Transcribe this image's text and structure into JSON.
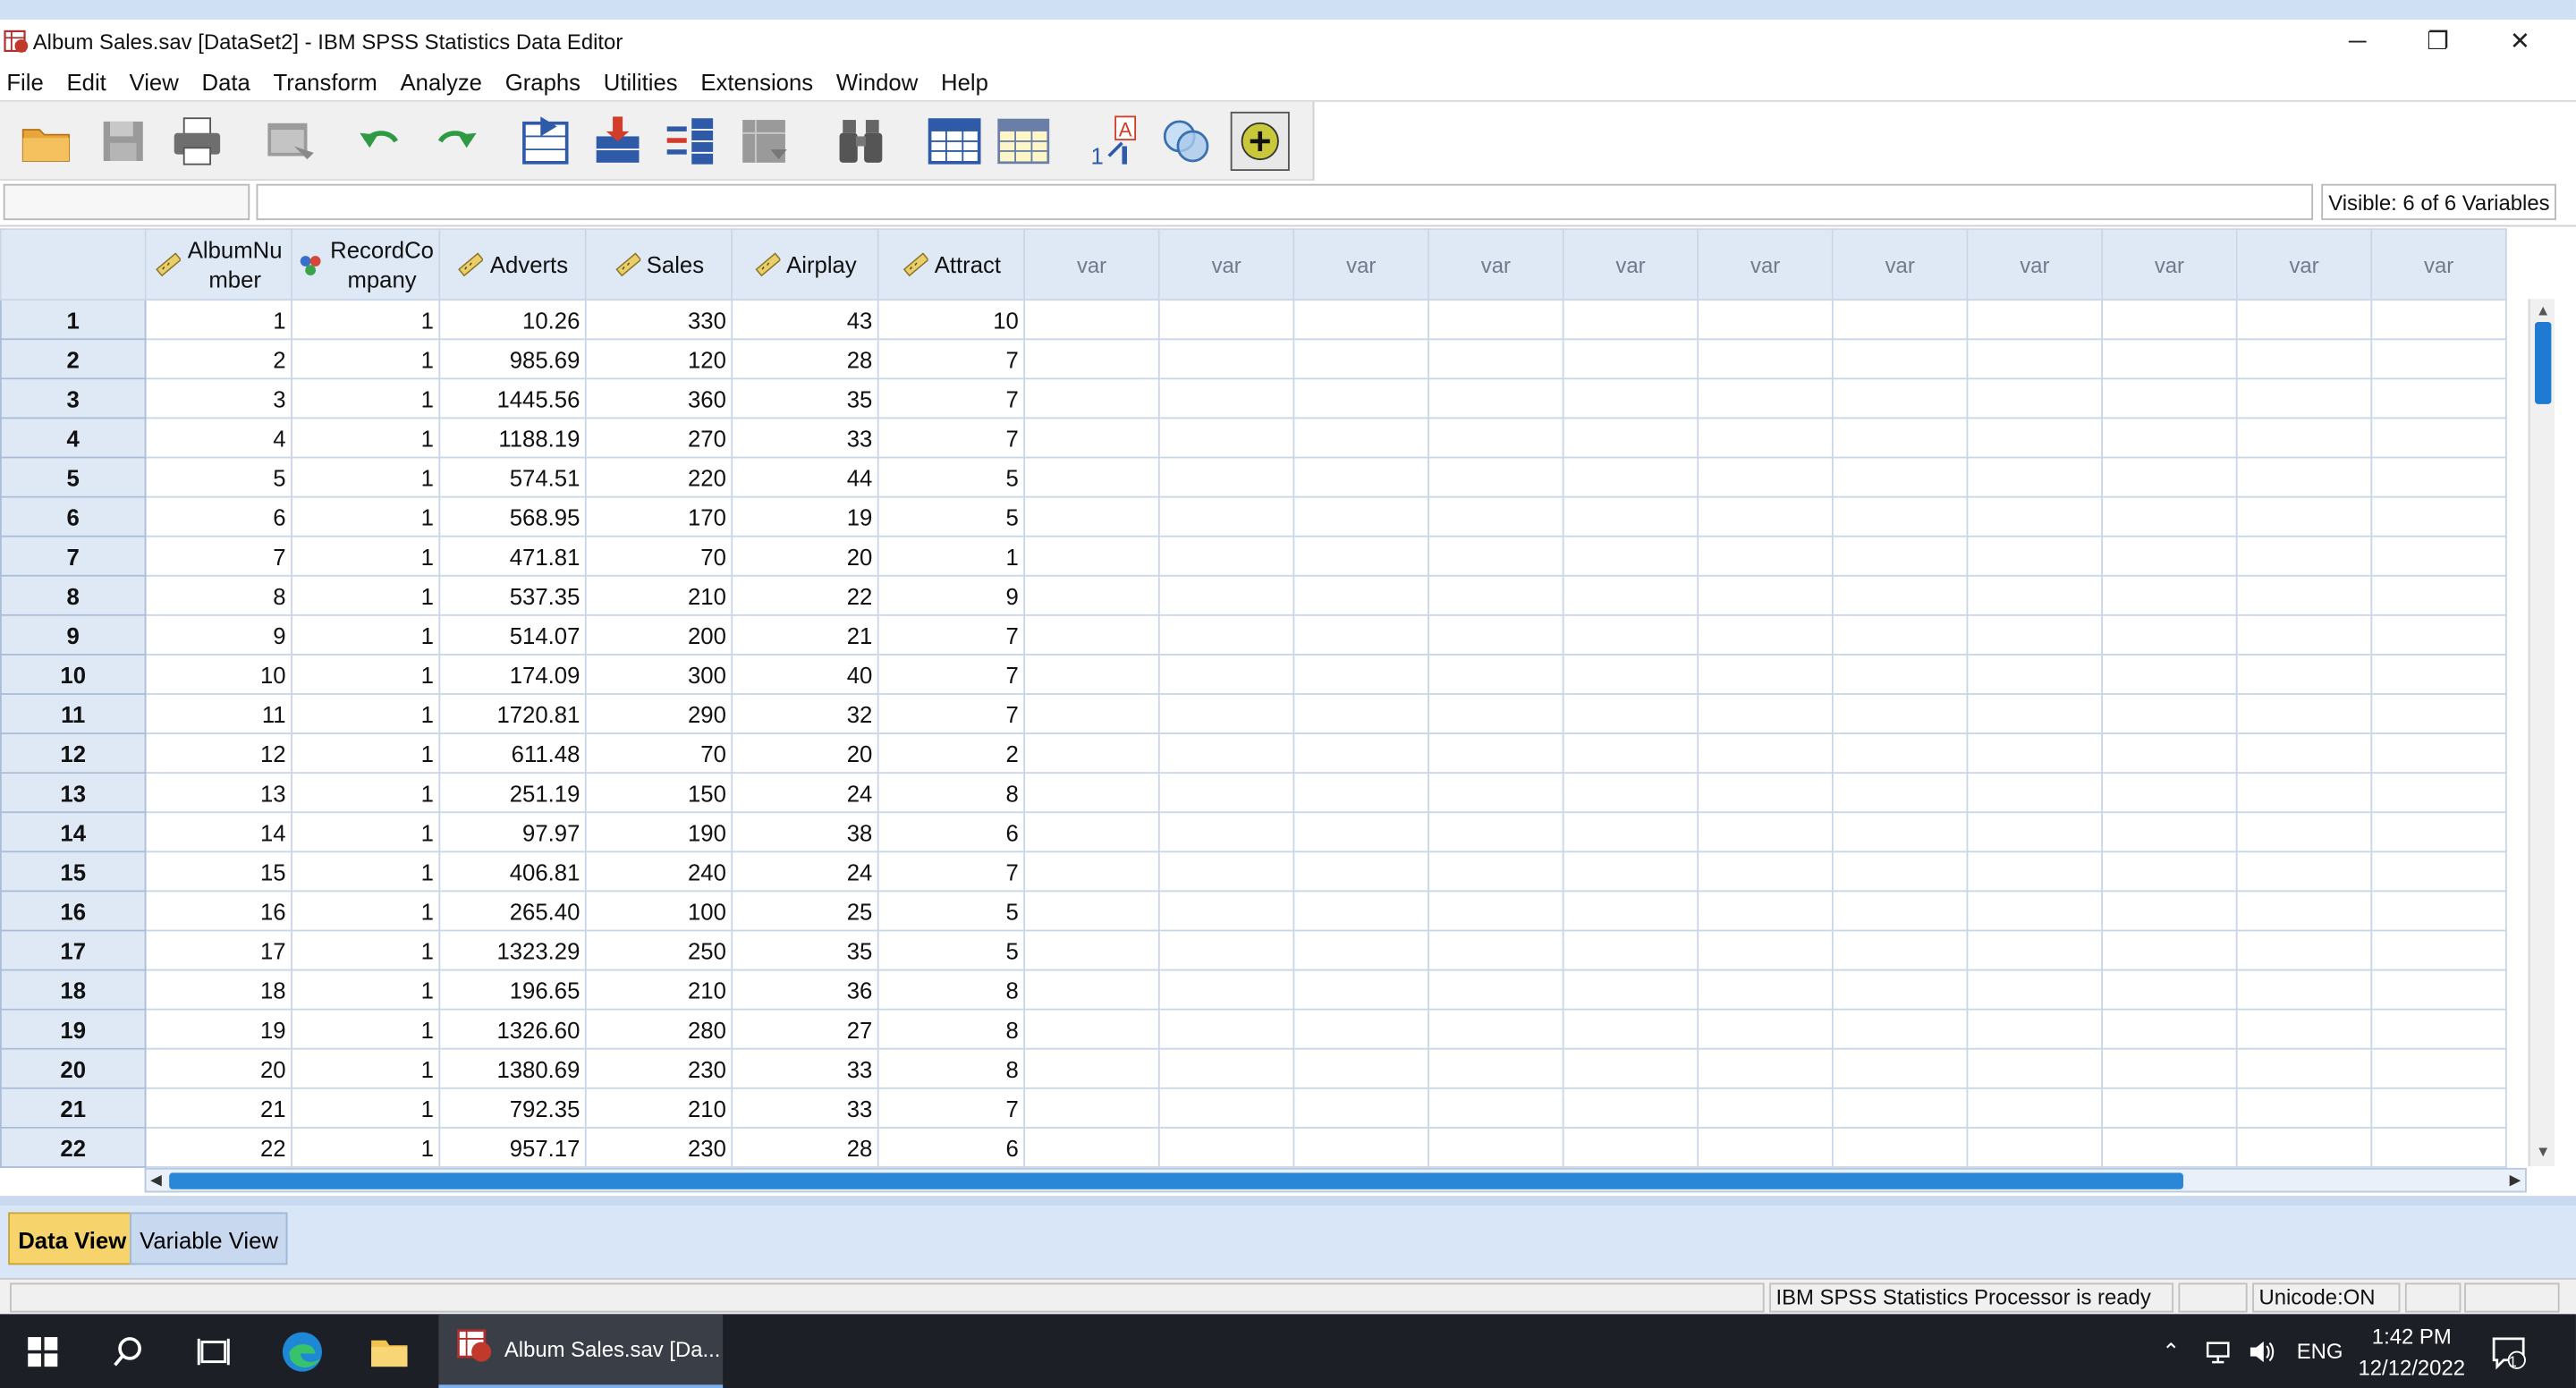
{
  "window": {
    "title": "Album Sales.sav [DataSet2] - IBM SPSS Statistics Data Editor",
    "controls": {
      "minimize": "─",
      "restore": "❐",
      "close": "✕"
    }
  },
  "menu": [
    {
      "label": "File"
    },
    {
      "label": "Edit"
    },
    {
      "label": "View"
    },
    {
      "label": "Data"
    },
    {
      "label": "Transform"
    },
    {
      "label": "Analyze"
    },
    {
      "label": "Graphs"
    },
    {
      "label": "Utilities"
    },
    {
      "label": "Extensions"
    },
    {
      "label": "Window"
    },
    {
      "label": "Help"
    }
  ],
  "toolbar": [
    {
      "name": "open-data-document-icon"
    },
    {
      "name": "save-icon"
    },
    {
      "name": "print-icon"
    },
    {
      "name": "recall-dialog-icon"
    },
    {
      "name": "undo-icon"
    },
    {
      "name": "redo-icon"
    },
    {
      "name": "go-to-case-icon"
    },
    {
      "name": "go-to-variable-icon"
    },
    {
      "name": "variables-icon"
    },
    {
      "name": "run-descriptives-icon"
    },
    {
      "name": "find-icon"
    },
    {
      "name": "insert-cases-icon"
    },
    {
      "name": "insert-variable-icon"
    },
    {
      "name": "value-labels-icon"
    },
    {
      "name": "use-variable-sets-icon"
    },
    {
      "name": "spelling-icon"
    }
  ],
  "cell_editor": {
    "reference": "",
    "value": ""
  },
  "visible_vars": "Visible: 6 of 6 Variables",
  "columns": [
    {
      "label": "AlbumNu\nmber",
      "icon": "scale-ruler-icon"
    },
    {
      "label": "RecordCo\nmpany",
      "icon": "nominal-circles-icon"
    },
    {
      "label": "Adverts",
      "icon": "scale-ruler-icon"
    },
    {
      "label": "Sales",
      "icon": "scale-ruler-icon"
    },
    {
      "label": "Airplay",
      "icon": "scale-ruler-icon"
    },
    {
      "label": "Attract",
      "icon": "scale-ruler-icon"
    }
  ],
  "empty_var_label": "var",
  "rows": [
    [
      "1",
      "1",
      "1",
      "10.26",
      "330",
      "43",
      "10"
    ],
    [
      "2",
      "2",
      "1",
      "985.69",
      "120",
      "28",
      "7"
    ],
    [
      "3",
      "3",
      "1",
      "1445.56",
      "360",
      "35",
      "7"
    ],
    [
      "4",
      "4",
      "1",
      "1188.19",
      "270",
      "33",
      "7"
    ],
    [
      "5",
      "5",
      "1",
      "574.51",
      "220",
      "44",
      "5"
    ],
    [
      "6",
      "6",
      "1",
      "568.95",
      "170",
      "19",
      "5"
    ],
    [
      "7",
      "7",
      "1",
      "471.81",
      "70",
      "20",
      "1"
    ],
    [
      "8",
      "8",
      "1",
      "537.35",
      "210",
      "22",
      "9"
    ],
    [
      "9",
      "9",
      "1",
      "514.07",
      "200",
      "21",
      "7"
    ],
    [
      "10",
      "10",
      "1",
      "174.09",
      "300",
      "40",
      "7"
    ],
    [
      "11",
      "11",
      "1",
      "1720.81",
      "290",
      "32",
      "7"
    ],
    [
      "12",
      "12",
      "1",
      "611.48",
      "70",
      "20",
      "2"
    ],
    [
      "13",
      "13",
      "1",
      "251.19",
      "150",
      "24",
      "8"
    ],
    [
      "14",
      "14",
      "1",
      "97.97",
      "190",
      "38",
      "6"
    ],
    [
      "15",
      "15",
      "1",
      "406.81",
      "240",
      "24",
      "7"
    ],
    [
      "16",
      "16",
      "1",
      "265.40",
      "100",
      "25",
      "5"
    ],
    [
      "17",
      "17",
      "1",
      "1323.29",
      "250",
      "35",
      "5"
    ],
    [
      "18",
      "18",
      "1",
      "196.65",
      "210",
      "36",
      "8"
    ],
    [
      "19",
      "19",
      "1",
      "1326.60",
      "280",
      "27",
      "8"
    ],
    [
      "20",
      "20",
      "1",
      "1380.69",
      "230",
      "33",
      "8"
    ],
    [
      "21",
      "21",
      "1",
      "792.35",
      "210",
      "33",
      "7"
    ],
    [
      "22",
      "22",
      "1",
      "957.17",
      "230",
      "28",
      "6"
    ]
  ],
  "tabs": {
    "data_view": "Data View",
    "variable_view": "Variable View"
  },
  "status": {
    "processor": "IBM SPSS Statistics Processor is ready",
    "unicode": "Unicode:ON"
  },
  "taskbar": {
    "app_label": "Album Sales.sav [Da...",
    "lang": "ENG",
    "time": "1:42 PM",
    "date": "12/12/2022",
    "notifications": "1"
  },
  "colors": {
    "accent": "#1f7ad1",
    "active_tab": "#f6d36b",
    "header_bg": "#dfe8f5"
  }
}
